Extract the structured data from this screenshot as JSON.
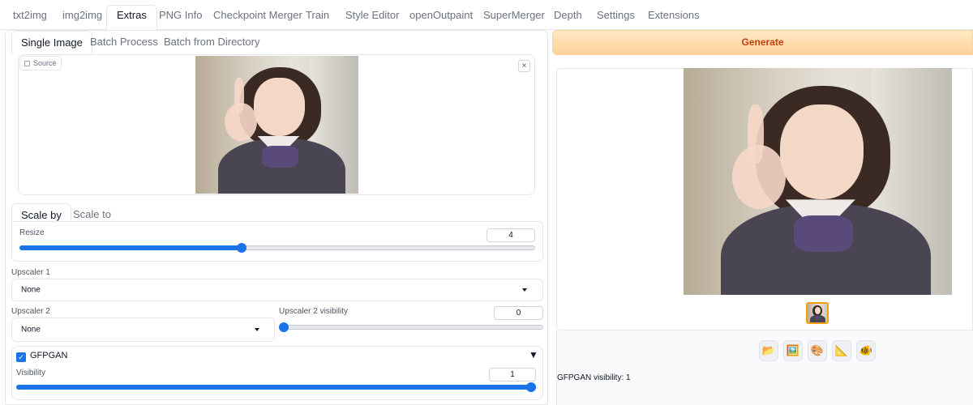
{
  "tabs": [
    {
      "label": "txt2img"
    },
    {
      "label": "img2img"
    },
    {
      "label": "Extras"
    },
    {
      "label": "PNG Info"
    },
    {
      "label": "Checkpoint Merger"
    },
    {
      "label": "Train"
    },
    {
      "label": "Style Editor"
    },
    {
      "label": "openOutpaint"
    },
    {
      "label": "SuperMerger"
    },
    {
      "label": "Depth"
    },
    {
      "label": "Settings"
    },
    {
      "label": "Extensions"
    }
  ],
  "active_tab": "Extras",
  "mode_tabs": [
    {
      "label": "Single Image"
    },
    {
      "label": "Batch Process"
    },
    {
      "label": "Batch from Directory"
    }
  ],
  "source": {
    "label": "Source",
    "close": "×"
  },
  "scale_tabs": [
    {
      "label": "Scale by"
    },
    {
      "label": "Scale to"
    }
  ],
  "resize": {
    "label": "Resize",
    "value": "4",
    "fraction": 0.43
  },
  "upscaler1": {
    "label": "Upscaler 1",
    "value": "None"
  },
  "upscaler2": {
    "label": "Upscaler 2",
    "value": "None"
  },
  "upscaler2_visibility": {
    "label": "Upscaler 2 visibility",
    "value": "0",
    "fraction": 0.0
  },
  "gfpgan": {
    "label": "GFPGAN",
    "checked": true,
    "collapse": "▼"
  },
  "gfpgan_visibility": {
    "label": "Visibility",
    "value": "1",
    "fraction": 1.0
  },
  "generate": {
    "label": "Generate"
  },
  "output_tools": [
    {
      "icon": "folder-icon",
      "glyph": "📂"
    },
    {
      "icon": "image-icon",
      "glyph": "🖼️"
    },
    {
      "icon": "palette-icon",
      "glyph": "🎨"
    },
    {
      "icon": "ruler-icon",
      "glyph": "📐"
    },
    {
      "icon": "fish-icon",
      "glyph": "🐠"
    }
  ],
  "status": "GFPGAN visibility: 1",
  "colors": {
    "accent": "#1a73e8",
    "generate_text": "#c2410c"
  }
}
